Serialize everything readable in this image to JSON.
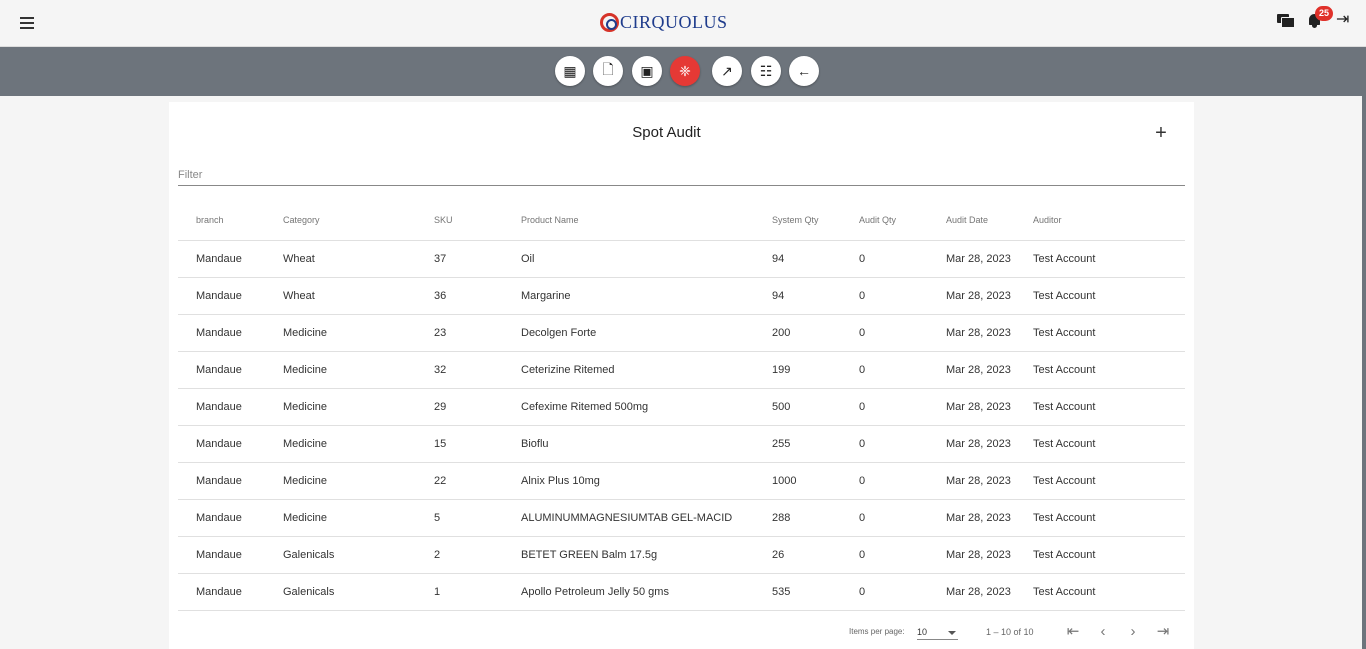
{
  "header": {
    "logo_text": "CIRQUOLUS",
    "notification_count": "25",
    "accent_color": "#e53935",
    "toolbar_color": "#6d747c"
  },
  "toolbar": {
    "buttons": [
      "dashboard-icon",
      "documents-icon",
      "cash-icon",
      "audit-icon",
      "trending-icon",
      "apps-grid-icon",
      "back-arrow-icon"
    ],
    "active_button": "audit-icon"
  },
  "page": {
    "title": "Spot Audit",
    "add_symbol": "+",
    "filter_placeholder": "Filter"
  },
  "table": {
    "columns": [
      "branch",
      "Category",
      "SKU",
      "Product Name",
      "System Qty",
      "Audit Qty",
      "Audit Date",
      "Auditor"
    ],
    "rows": [
      [
        "Mandaue",
        "Wheat",
        "37",
        "Oil",
        "94",
        "0",
        "Mar 28, 2023",
        "Test Account"
      ],
      [
        "Mandaue",
        "Wheat",
        "36",
        "Margarine",
        "94",
        "0",
        "Mar 28, 2023",
        "Test Account"
      ],
      [
        "Mandaue",
        "Medicine",
        "23",
        "Decolgen Forte",
        "200",
        "0",
        "Mar 28, 2023",
        "Test Account"
      ],
      [
        "Mandaue",
        "Medicine",
        "32",
        "Ceterizine Ritemed",
        "199",
        "0",
        "Mar 28, 2023",
        "Test Account"
      ],
      [
        "Mandaue",
        "Medicine",
        "29",
        "Cefexime Ritemed 500mg",
        "500",
        "0",
        "Mar 28, 2023",
        "Test Account"
      ],
      [
        "Mandaue",
        "Medicine",
        "15",
        "Bioflu",
        "255",
        "0",
        "Mar 28, 2023",
        "Test Account"
      ],
      [
        "Mandaue",
        "Medicine",
        "22",
        "Alnix Plus 10mg",
        "1000",
        "0",
        "Mar 28, 2023",
        "Test Account"
      ],
      [
        "Mandaue",
        "Medicine",
        "5",
        "ALUMINUMMAGNESIUMTAB GEL-MACID",
        "288",
        "0",
        "Mar 28, 2023",
        "Test Account"
      ],
      [
        "Mandaue",
        "Galenicals",
        "2",
        "BETET GREEN Balm 17.5g",
        "26",
        "0",
        "Mar 28, 2023",
        "Test Account"
      ],
      [
        "Mandaue",
        "Galenicals",
        "1",
        "Apollo Petroleum Jelly 50 gms",
        "535",
        "0",
        "Mar 28, 2023",
        "Test Account"
      ]
    ]
  },
  "paginator": {
    "items_per_page_label": "Items per page:",
    "page_size": "10",
    "range_label": "1 – 10 of 10"
  }
}
